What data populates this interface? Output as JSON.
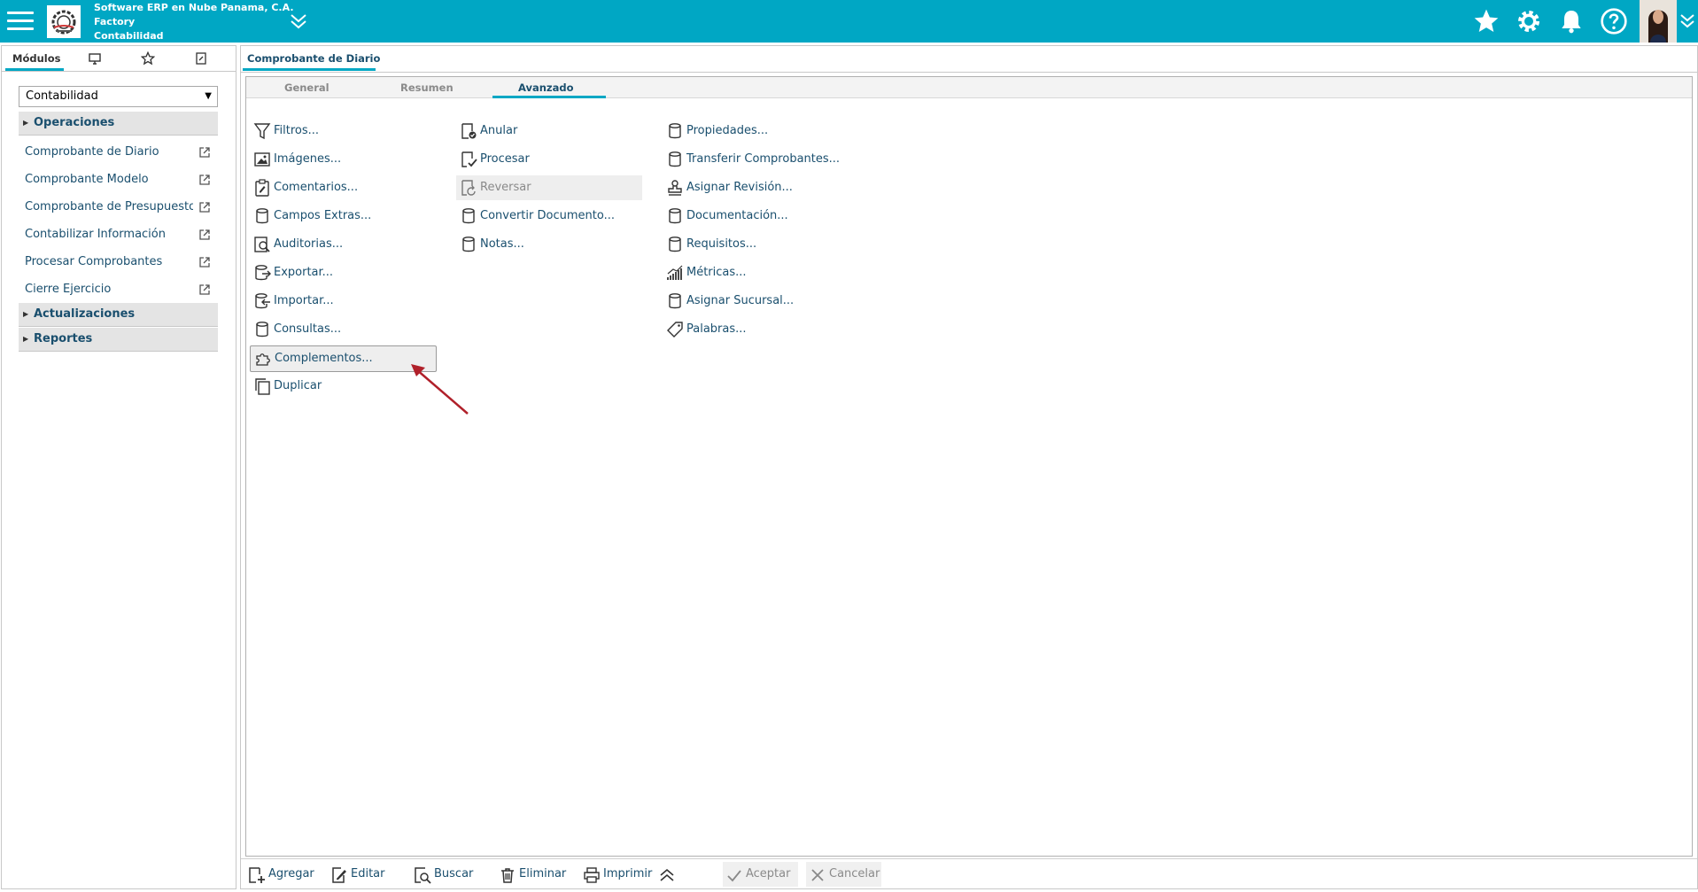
{
  "header": {
    "company": "Software ERP en Nube Panama, C.A.",
    "branch": "Factory",
    "module": "Contabilidad",
    "icons": [
      "menu-icon",
      "star-icon",
      "gear-icon",
      "bell-icon",
      "help-icon",
      "chevron-down-icon"
    ],
    "accent_color": "#00a7c4"
  },
  "left_panel": {
    "tab_label": "Módulos",
    "tab_icons": [
      "monitor-icon",
      "star-outline-icon",
      "note-icon"
    ],
    "selected_module": "Contabilidad",
    "sections": [
      {
        "label": "Operaciones"
      },
      {
        "label": "Actualizaciones"
      },
      {
        "label": "Reportes"
      }
    ],
    "items": [
      {
        "label": "Comprobante de Diario"
      },
      {
        "label": "Comprobante Modelo"
      },
      {
        "label": "Comprobante de Presupuesto"
      },
      {
        "label": "Contabilizar Información"
      },
      {
        "label": "Procesar Comprobantes"
      },
      {
        "label": "Cierre Ejercicio"
      }
    ]
  },
  "main": {
    "tab_title": "Comprobante de Diario",
    "inner_tabs": [
      {
        "label": "General"
      },
      {
        "label": "Resumen"
      },
      {
        "label": "Avanzado"
      }
    ],
    "actions_col1": [
      {
        "label": "Filtros...",
        "icon": "filter-icon"
      },
      {
        "label": "Imágenes...",
        "icon": "image-icon"
      },
      {
        "label": "Comentarios...",
        "icon": "clipboard-icon"
      },
      {
        "label": "Campos Extras...",
        "icon": "database-icon"
      },
      {
        "label": "Auditorias...",
        "icon": "audit-icon"
      },
      {
        "label": "Exportar...",
        "icon": "export-icon"
      },
      {
        "label": "Importar...",
        "icon": "import-icon"
      },
      {
        "label": "Consultas...",
        "icon": "database-icon"
      },
      {
        "label": "Complementos...",
        "icon": "puzzle-icon"
      },
      {
        "label": "Duplicar",
        "icon": "copy-icon"
      }
    ],
    "actions_col2": [
      {
        "label": "Anular",
        "icon": "void-doc-icon"
      },
      {
        "label": "Procesar",
        "icon": "process-doc-icon"
      },
      {
        "label": "Reversar",
        "icon": "reverse-doc-icon"
      },
      {
        "label": "Convertir Documento...",
        "icon": "database-icon"
      },
      {
        "label": "Notas...",
        "icon": "database-icon"
      }
    ],
    "actions_col3": [
      {
        "label": "Propiedades...",
        "icon": "database-icon"
      },
      {
        "label": "Transferir Comprobantes...",
        "icon": "database-icon"
      },
      {
        "label": "Asignar Revisión...",
        "icon": "stamp-icon"
      },
      {
        "label": "Documentación...",
        "icon": "database-icon"
      },
      {
        "label": "Requisitos...",
        "icon": "database-icon"
      },
      {
        "label": "Métricas...",
        "icon": "chart-icon"
      },
      {
        "label": "Asignar Sucursal...",
        "icon": "database-icon"
      },
      {
        "label": "Palabras...",
        "icon": "tag-icon"
      }
    ],
    "footer": {
      "add": "Agregar",
      "edit": "Editar",
      "search": "Buscar",
      "delete": "Eliminar",
      "print": "Imprimir",
      "accept": "Aceptar",
      "cancel": "Cancelar"
    }
  }
}
